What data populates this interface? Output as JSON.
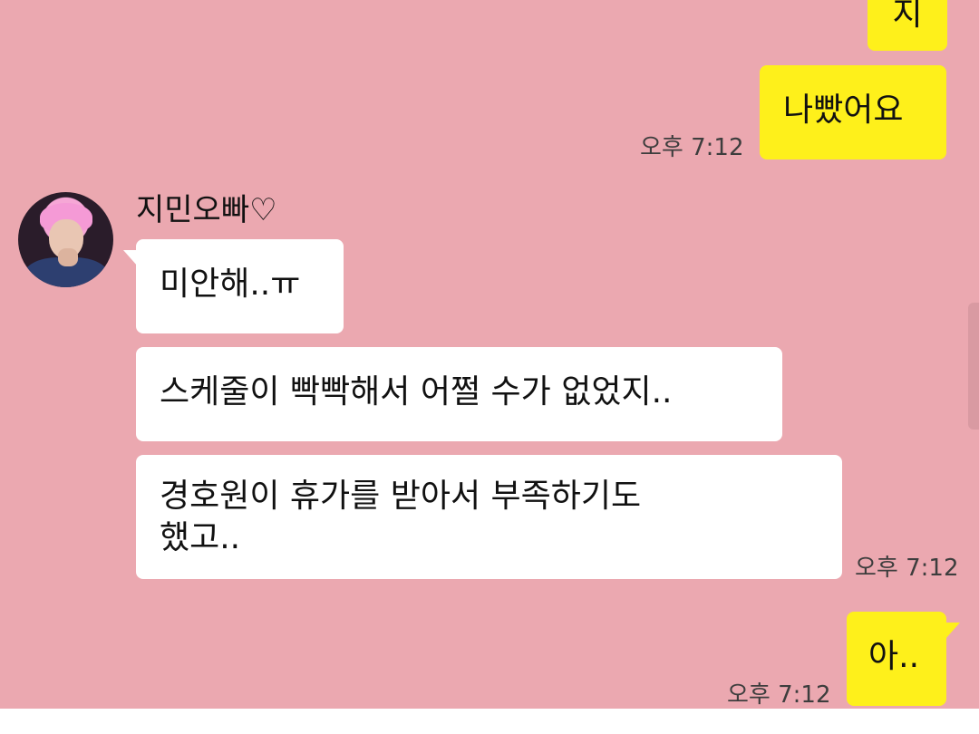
{
  "chat": {
    "messages": [
      {
        "sender": "me",
        "text": "지"
      },
      {
        "sender": "me",
        "text": "나빴어요",
        "time": "오후 7:12"
      },
      {
        "sender": "them",
        "name": "지민오빠♡",
        "text": "미안해..ㅠ"
      },
      {
        "sender": "them",
        "text": "스케줄이 빡빡해서 어쩔 수가 없었지.."
      },
      {
        "sender": "them",
        "text_line1": "경호원이 휴가를 받아서 부족하기도",
        "text_line2": "했고..",
        "time": "오후 7:12"
      },
      {
        "sender": "me",
        "text": "아..",
        "time": "오후 7:12"
      }
    ]
  }
}
